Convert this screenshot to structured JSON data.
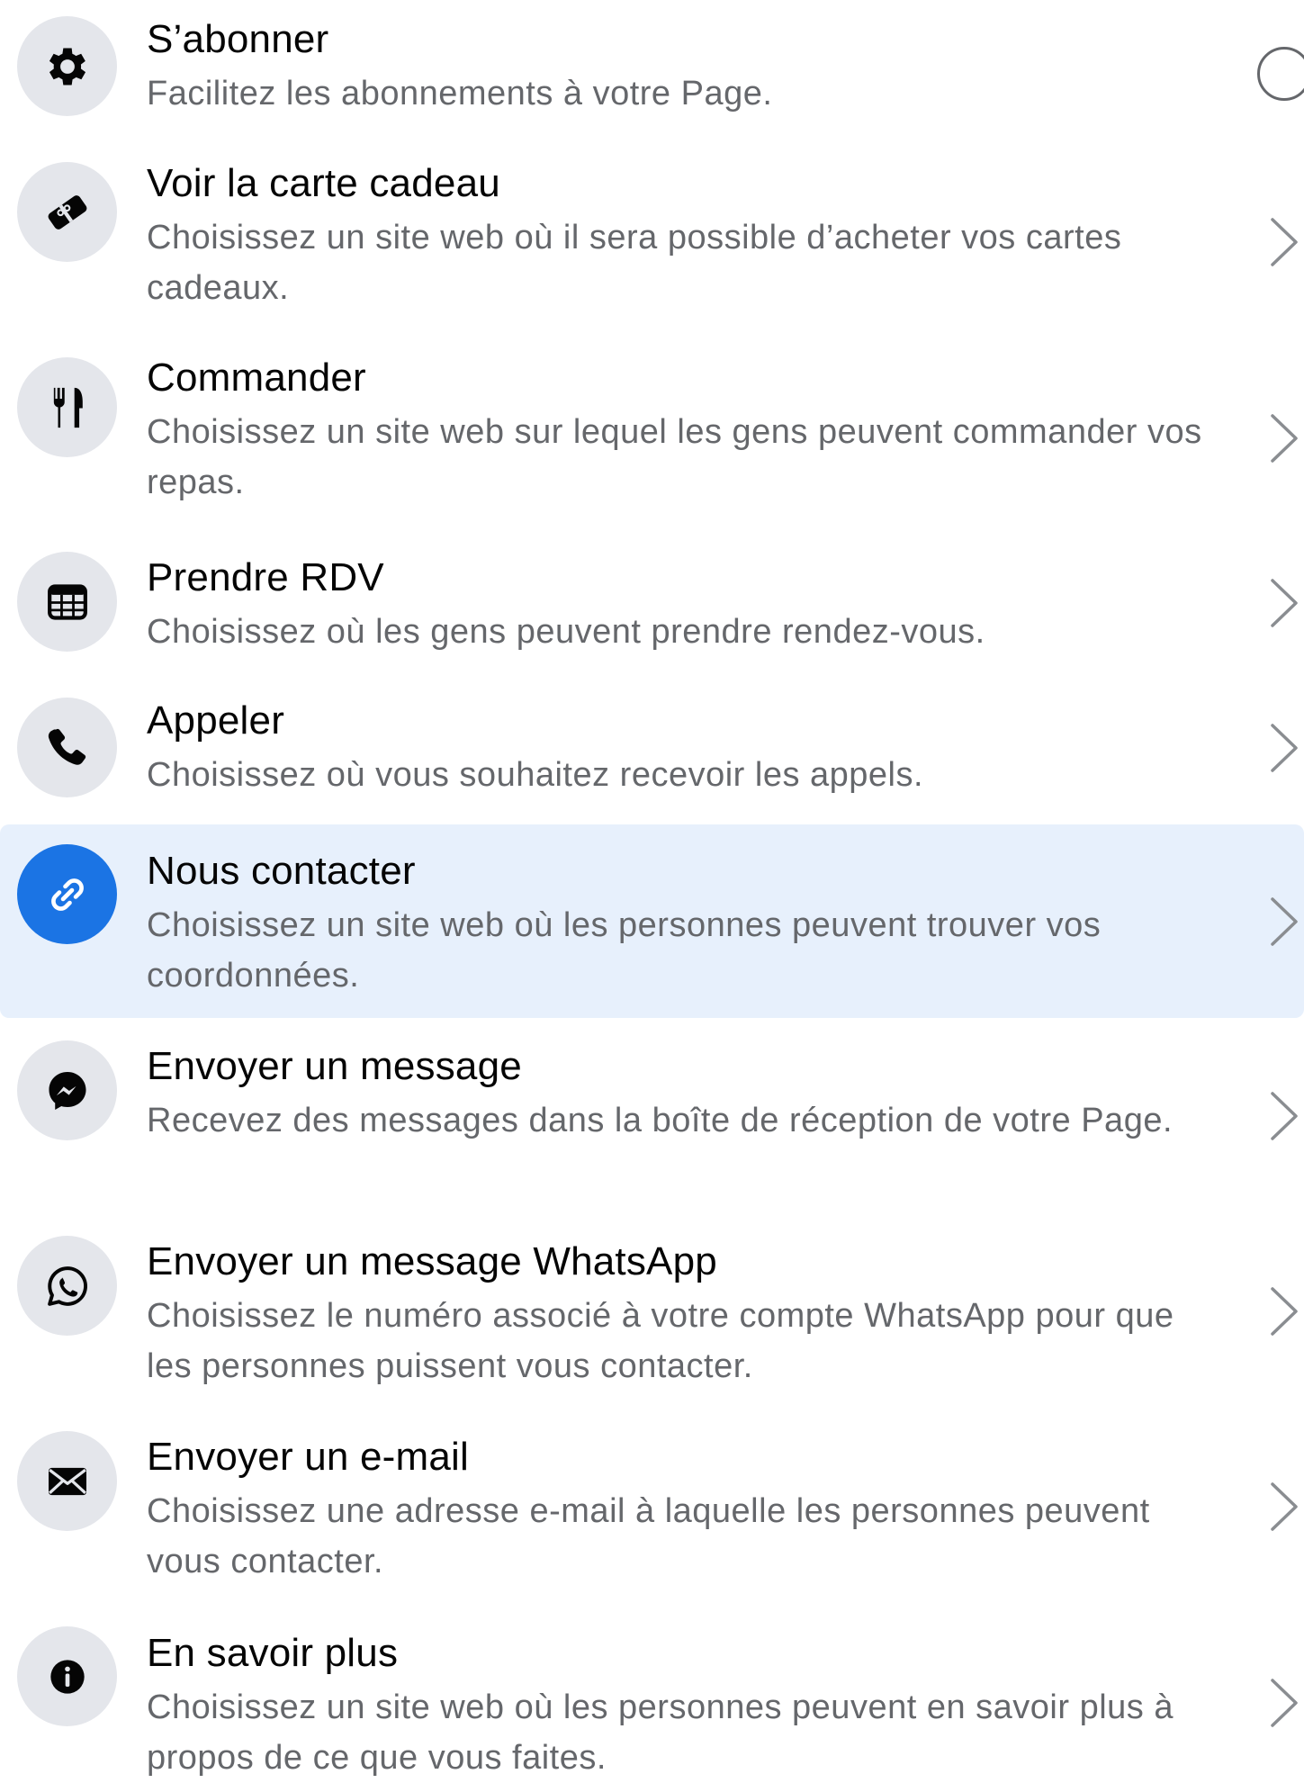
{
  "colors": {
    "icon_bg": "#e4e6eb",
    "icon_fg": "#050505",
    "selected_bg": "#e7f0fc",
    "selected_icon_bg": "#1b74e4",
    "selected_icon_fg": "#ffffff",
    "title": "#050505",
    "description": "#65676b",
    "chevron": "#8a8d91"
  },
  "items": [
    {
      "title": "S’abonner",
      "description": "Facilitez les abonnements à votre Page.",
      "icon": "gear-icon",
      "control": "radio",
      "radio_selected": false,
      "selected": false
    },
    {
      "title": "Voir la carte cadeau",
      "description": "Choisissez un site web où il sera possible d’acheter vos cartes cadeaux.",
      "icon": "gift-card-icon",
      "control": "chevron",
      "selected": false
    },
    {
      "title": "Commander",
      "description": "Choisissez un site web sur lequel les gens peuvent commander vos repas.",
      "icon": "fork-knife-icon",
      "control": "chevron",
      "selected": false
    },
    {
      "title": "Prendre RDV",
      "description": "Choisissez où les gens peuvent prendre rendez-vous.",
      "icon": "calendar-icon",
      "control": "chevron",
      "selected": false
    },
    {
      "title": "Appeler",
      "description": "Choisissez où vous souhaitez recevoir les appels.",
      "icon": "phone-icon",
      "control": "chevron",
      "selected": false
    },
    {
      "title": "Nous contacter",
      "description": "Choisissez un site web où les personnes peuvent trouver vos coordonnées.",
      "icon": "link-icon",
      "control": "chevron",
      "selected": true
    },
    {
      "title": "Envoyer un message",
      "description": "Recevez des messages dans la boîte de réception de votre Page.",
      "icon": "messenger-icon",
      "control": "chevron",
      "selected": false
    },
    {
      "title": "Envoyer un message WhatsApp",
      "description": "Choisissez le numéro associé à votre compte WhatsApp pour que les personnes puissent vous contacter.",
      "icon": "whatsapp-icon",
      "control": "chevron",
      "selected": false
    },
    {
      "title": "Envoyer un e-mail",
      "description": "Choisissez une adresse e-mail à laquelle les personnes peuvent vous contacter.",
      "icon": "envelope-icon",
      "control": "chevron",
      "selected": false
    },
    {
      "title": "En savoir plus",
      "description": "Choisissez un site web où les personnes peuvent en savoir plus à propos de ce que vous faites.",
      "icon": "info-icon",
      "control": "chevron",
      "selected": false
    }
  ]
}
